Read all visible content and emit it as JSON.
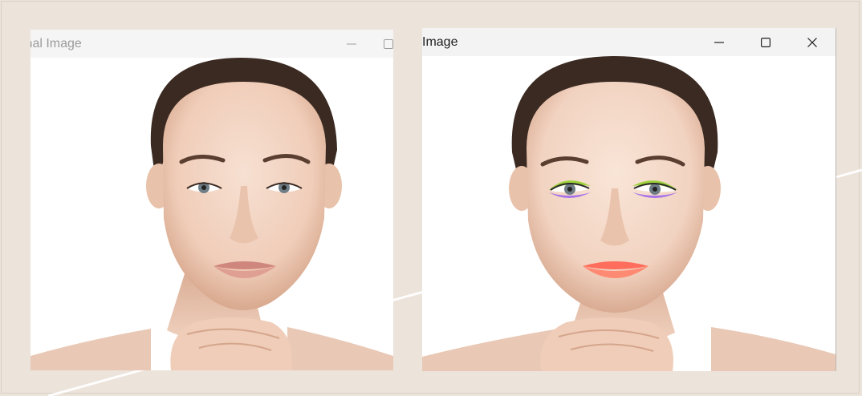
{
  "windows": {
    "left": {
      "title": "inal Image",
      "controls": [
        "minimize-icon",
        "maximize-icon"
      ],
      "image": {
        "subject": "portrait-no-makeup"
      }
    },
    "right": {
      "title": "Image",
      "controls": [
        "minimize-icon",
        "maximize-icon",
        "close-icon"
      ],
      "image": {
        "subject": "portrait-with-virtual-makeup"
      }
    }
  },
  "colors": {
    "background": "#ece3da",
    "skin": "#f1d3c0",
    "hair": "#3a2a22",
    "lips_natural": "#d9958a",
    "lips_makeup": "#ff6e5c",
    "eyeshadow_upper": "#9ed23c",
    "eyeshadow_lower": "#a874e8"
  }
}
